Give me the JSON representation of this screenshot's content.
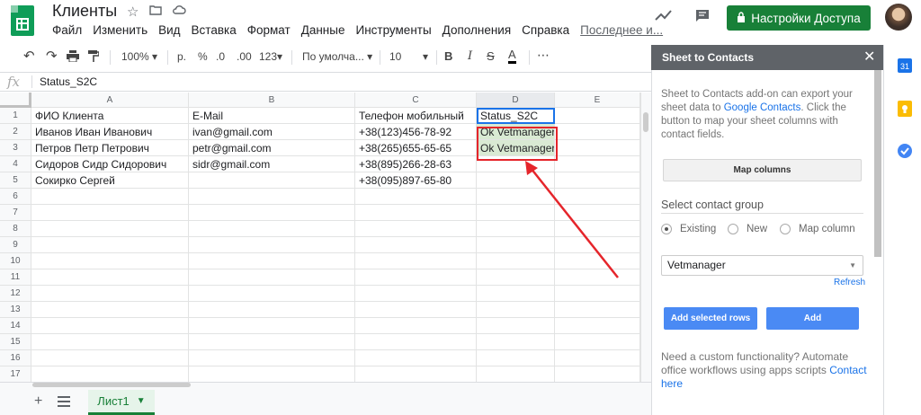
{
  "doc": {
    "title": "Клиенты"
  },
  "menu": [
    "Файл",
    "Изменить",
    "Вид",
    "Вставка",
    "Формат",
    "Данные",
    "Инструменты",
    "Дополнения",
    "Справка"
  ],
  "menu_last": "Последнее и...",
  "share_label": "Настройки Доступа",
  "toolbar": {
    "zoom": "100%",
    "currency": "р.",
    "percent": "%",
    "dec_less": ".0",
    "dec_more": ".00",
    "format": "123",
    "font": "По умолча...",
    "size": "10",
    "bold": "B",
    "italic": "I",
    "strike": "S",
    "textcolor": "A",
    "more": "⋯"
  },
  "formula": {
    "fx": "fx",
    "value": "Status_S2C"
  },
  "columns": [
    "A",
    "B",
    "C",
    "D",
    "E"
  ],
  "rows": [
    "1",
    "2",
    "3",
    "4",
    "5",
    "6",
    "7",
    "8",
    "9",
    "10",
    "11",
    "12",
    "13",
    "14",
    "15",
    "16",
    "17"
  ],
  "cells": [
    [
      "ФИО Клиента",
      "E-Mail",
      "Телефон мобильный",
      "Status_S2C",
      ""
    ],
    [
      "Иванов Иван Иванович",
      "ivan@gmail.com",
      "+38(123)456-78-92",
      "Ok Vetmanager",
      ""
    ],
    [
      "Петров Петр Петрович",
      "petr@gmail.com",
      "+38(265)655-65-65",
      "Ok Vetmanager",
      ""
    ],
    [
      "Сидоров Сидр Сидорович",
      "sidr@gmail.com",
      "+38(895)266-28-63",
      "",
      ""
    ],
    [
      "Сокирко Сергей",
      "",
      "+38(095)897-65-80",
      "",
      ""
    ]
  ],
  "sheet_tab": "Лист1",
  "panel": {
    "title": "Sheet to Contacts",
    "intro_1": "Sheet to Contacts add-on can export your sheet data to",
    "intro_link": "Google Contacts",
    "intro_2": ". Click the button to map your sheet columns with contact fields.",
    "map_button": "Map columns",
    "group_heading": "Select contact group",
    "radio_existing": "Existing",
    "radio_new": "New",
    "radio_map": "Map column",
    "select_value": "Vetmanager",
    "refresh": "Refresh",
    "add_selected": "Add selected rows",
    "add": "Add",
    "footer_1": "Need a custom functionality? Automate office workflows using apps scripts",
    "footer_link": "Contact here"
  },
  "colors": {
    "accent": "#188038",
    "highlight": "#d9ead3",
    "annotation": "#e5252b",
    "link": "#1a73e8"
  }
}
